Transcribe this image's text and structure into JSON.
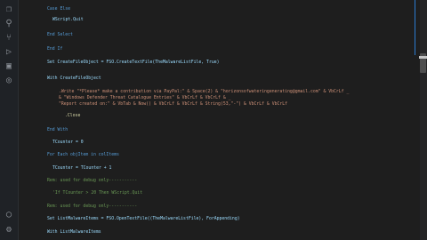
{
  "activity_bar": {
    "icons": [
      "files-icon",
      "search-icon",
      "source-control-icon",
      "run-debug-icon",
      "extensions-icon",
      "remote-icon",
      "account-icon",
      "gear-icon"
    ]
  },
  "code_lines": [
    "Case Else",
    "WScript.Quit",
    "End Select",
    "End If",
    "Set CreateFileObject = FSO.CreateTextFile(TheMalwareListFile, True)",
    "With CreateFileObject",
    ".Write \"*Please* make a contribution via PayPal:\" & Space(2) & \"horizonsofwateringenerating@gmail.com\" & VbCrLf _",
    "& \"Windows Defender Threat Catalogue Entries\" & VbCrLf & VbCrLf & _",
    "\"Report created on:\" & VbTab & Now() & VbCrLf & VbCrLf & String(53,\"-\") & VbCrLf & VbCrLf",
    ".Close",
    "End With",
    "TCounter = 0",
    "For Each objItem in colItems",
    "TCounter = TCounter + 1",
    "Rem: used for debug only-----------",
    "'If TCounter > 20 Then WScript.Quit",
    "Rem: used for debug only-----------",
    "Set ListMalwareItems = FSO.OpenTextFile((TheMalwareListFile), ForAppending)",
    "With ListMalwareItems"
  ]
}
